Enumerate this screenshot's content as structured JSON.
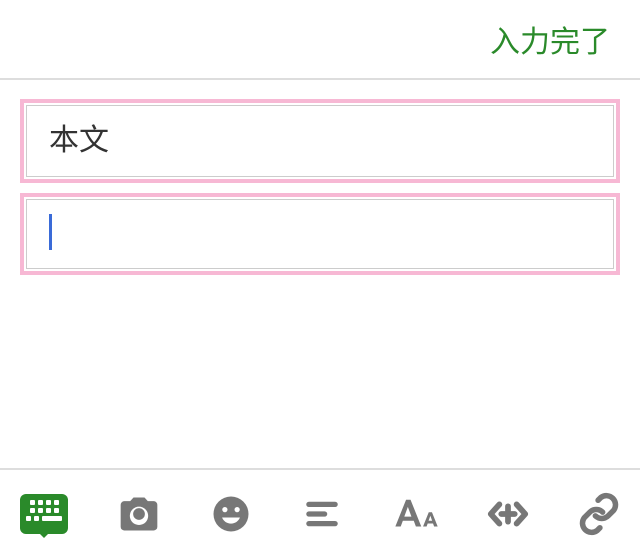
{
  "header": {
    "done_label": "入力完了"
  },
  "editor": {
    "title_placeholder": "本文",
    "title_value": "",
    "body_value": ""
  },
  "toolbar": {
    "keyboard_label": "keyboard",
    "camera_label": "camera",
    "emoji_label": "emoji",
    "align_label": "align",
    "font_label": "font-size",
    "code_label": "code",
    "link_label": "link"
  },
  "colors": {
    "accent": "#2a8a2a",
    "highlight_border": "#f7b8d4",
    "cursor": "#3a6bd8",
    "icon_inactive": "#777777"
  }
}
